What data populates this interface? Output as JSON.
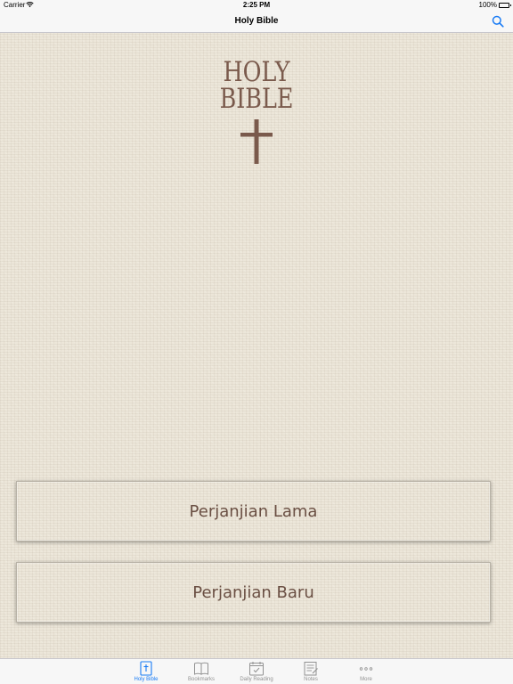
{
  "status_bar": {
    "carrier": "Carrier",
    "time": "2:25 PM",
    "battery": "100%",
    "wifi_icon": "wifi-icon",
    "battery_icon": "battery-icon"
  },
  "nav": {
    "title": "Holy Bible",
    "search_icon": "search-icon"
  },
  "logo": {
    "line1": "HOLY",
    "line2": "BIBLE",
    "cross_icon": "cross-icon"
  },
  "buttons": {
    "old_testament": "Perjanjian Lama",
    "new_testament": "Perjanjian Baru"
  },
  "tabs": [
    {
      "label": "Holy Bible",
      "icon": "bible-icon",
      "active": true
    },
    {
      "label": "Bookmarks",
      "icon": "open-book-icon",
      "active": false
    },
    {
      "label": "Daily Reading",
      "icon": "calendar-check-icon",
      "active": false
    },
    {
      "label": "Notes",
      "icon": "notepad-icon",
      "active": false
    },
    {
      "label": "More",
      "icon": "more-dots-icon",
      "active": false
    }
  ],
  "colors": {
    "accent": "#1a7cf5",
    "logo_brown": "#7a5a4c",
    "button_text": "#6a4f43",
    "background": "#ece6d9"
  }
}
